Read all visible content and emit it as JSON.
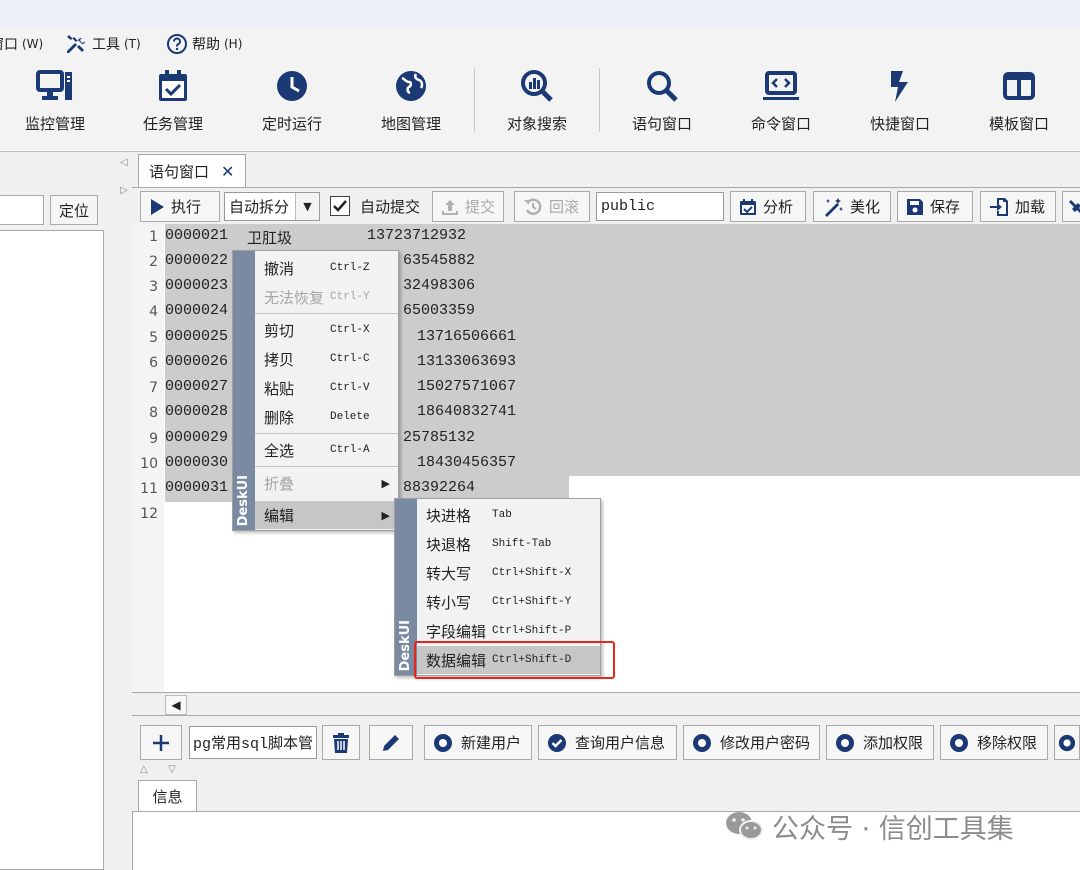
{
  "menubar": {
    "window": "窗口",
    "window_acc": "(W)",
    "tools": "工具",
    "tools_acc": "(T)",
    "help": "帮助",
    "help_acc": "(H)"
  },
  "toolbar": {
    "monitor": "监控管理",
    "task": "任务管理",
    "timer": "定时运行",
    "map": "地图管理",
    "objsearch": "对象搜索",
    "stmtwin": "语句窗口",
    "cmdwin": "命令窗口",
    "quickwin": "快捷窗口",
    "templatewin": "模板窗口"
  },
  "left": {
    "locate": "定位"
  },
  "tabs": {
    "stmt": "语句窗口",
    "close": "✕"
  },
  "editor_toolbar": {
    "execute": "执行",
    "split_mode": "自动拆分",
    "autocommit": "自动提交",
    "commit": "提交",
    "rollback": "回滚",
    "schema": "public",
    "analyze": "分析",
    "beautify": "美化",
    "save": "保存",
    "load": "加载"
  },
  "editor": {
    "line_numbers": [
      "1",
      "2",
      "3",
      "4",
      "5",
      "6",
      "7",
      "8",
      "9",
      "10",
      "11",
      "12"
    ],
    "lines": [
      {
        "id": "0000021",
        "name": "卫肛圾",
        "phone": "13723712932"
      },
      {
        "id": "0000022",
        "name": "",
        "phone": "63545882"
      },
      {
        "id": "0000023",
        "name": "",
        "phone": "32498306"
      },
      {
        "id": "0000024",
        "name": "",
        "phone": "65003359"
      },
      {
        "id": "0000025",
        "name": "",
        "phone": "13716506661"
      },
      {
        "id": "0000026",
        "name": "",
        "phone": "13133063693"
      },
      {
        "id": "0000027",
        "name": "",
        "phone": "15027571067"
      },
      {
        "id": "0000028",
        "name": "",
        "phone": "18640832741"
      },
      {
        "id": "0000029",
        "name": "",
        "phone": "25785132"
      },
      {
        "id": "0000030",
        "name": "",
        "phone": "18430456357"
      },
      {
        "id": "0000031",
        "name": "",
        "phone": "88392264"
      }
    ]
  },
  "context_menu": {
    "brand": "DeskUI",
    "items": [
      {
        "label": "撤消",
        "shortcut": "Ctrl-Z"
      },
      {
        "label": "无法恢复",
        "shortcut": "Ctrl-Y"
      },
      {
        "label": "剪切",
        "shortcut": "Ctrl-X"
      },
      {
        "label": "拷贝",
        "shortcut": "Ctrl-C"
      },
      {
        "label": "粘贴",
        "shortcut": "Ctrl-V"
      },
      {
        "label": "删除",
        "shortcut": "Delete"
      },
      {
        "label": "全选",
        "shortcut": "Ctrl-A"
      },
      {
        "label": "折叠",
        "shortcut": ""
      },
      {
        "label": "编辑",
        "shortcut": ""
      }
    ]
  },
  "edit_submenu": {
    "brand": "DeskUI",
    "items": [
      {
        "label": "块进格",
        "shortcut": "Tab"
      },
      {
        "label": "块退格",
        "shortcut": "Shift-Tab"
      },
      {
        "label": "转大写",
        "shortcut": "Ctrl+Shift-X"
      },
      {
        "label": "转小写",
        "shortcut": "Ctrl+Shift-Y"
      },
      {
        "label": "字段编辑",
        "shortcut": "Ctrl+Shift-P"
      },
      {
        "label": "数据编辑",
        "shortcut": "Ctrl+Shift-D"
      }
    ]
  },
  "snippets": {
    "script_name": "pg常用sql脚本管",
    "new_user": "新建用户",
    "query_user": "查询用户信息",
    "modify_pwd": "修改用户密码",
    "add_perm": "添加权限",
    "remove_perm": "移除权限"
  },
  "bottom": {
    "info_tab": "信息"
  },
  "watermark": {
    "text": "公众号 · 信创工具集"
  },
  "colors": {
    "icon": "#1b3a75",
    "highlight": "#e8261c",
    "selection": "#cccccc",
    "brand": "#7a8aa3"
  }
}
